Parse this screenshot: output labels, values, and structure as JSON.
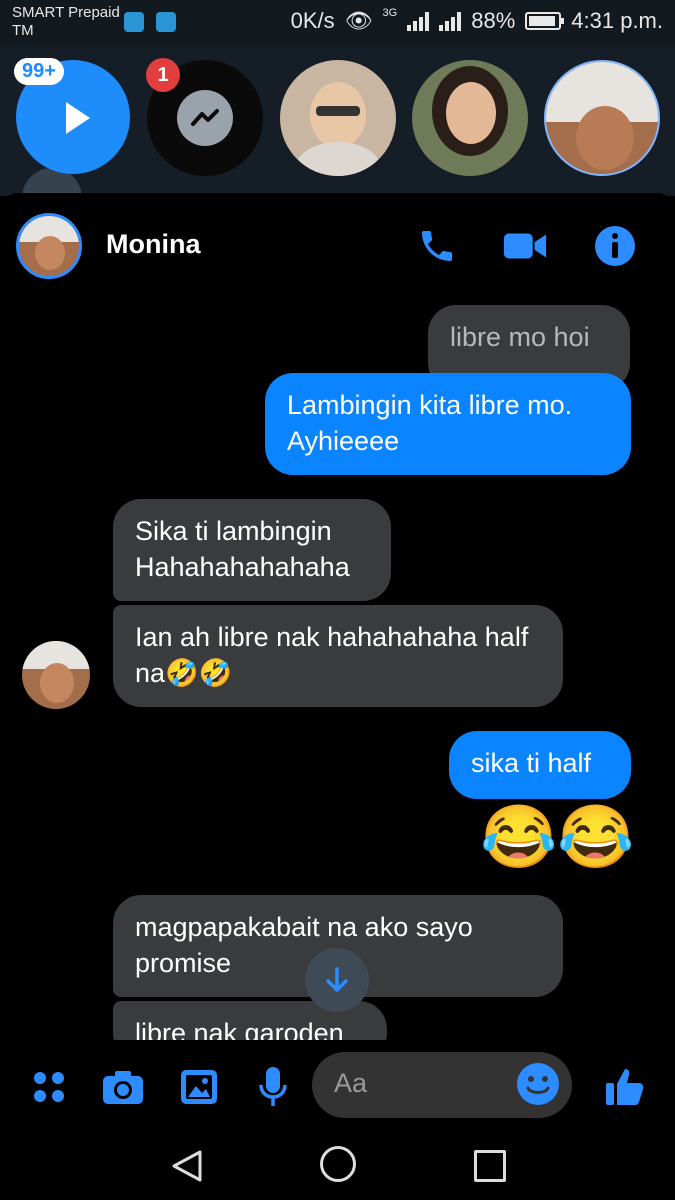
{
  "status_bar": {
    "carrier_line1": "SMART Prepaid",
    "carrier_line2": "TM",
    "speed": "0K/s",
    "network": "3G",
    "battery": "88%",
    "time": "4:31 p.m."
  },
  "chat_heads": {
    "video_badge": "99+",
    "messenger_badge": "1"
  },
  "conversation": {
    "contact_name": "Monina",
    "messages": [
      {
        "side": "in",
        "text": "libre mo hoi"
      },
      {
        "side": "out",
        "text": "Lambingin kita libre mo. Ayhieeee"
      },
      {
        "side": "in",
        "text": "Sika ti lambingin Hahahahahahaha"
      },
      {
        "side": "in",
        "text": "Ian ah libre nak hahahahaha half na🤣🤣"
      },
      {
        "side": "out",
        "text": "sika ti half"
      },
      {
        "side": "out",
        "text": "😂😂"
      },
      {
        "side": "in",
        "text": "magpapakabait na ako sayo promise"
      },
      {
        "side": "in",
        "text": "libre nak garoden"
      }
    ]
  },
  "composer": {
    "placeholder": "Aa"
  },
  "colors": {
    "accent": "#0a84ff",
    "incoming_bubble": "#3a3b3c",
    "background": "#000000"
  },
  "icons": [
    "call-icon",
    "video-call-icon",
    "info-icon",
    "more-apps-icon",
    "camera-icon",
    "gallery-icon",
    "microphone-icon",
    "emoji-icon",
    "thumbs-up-icon",
    "scroll-down-icon"
  ]
}
